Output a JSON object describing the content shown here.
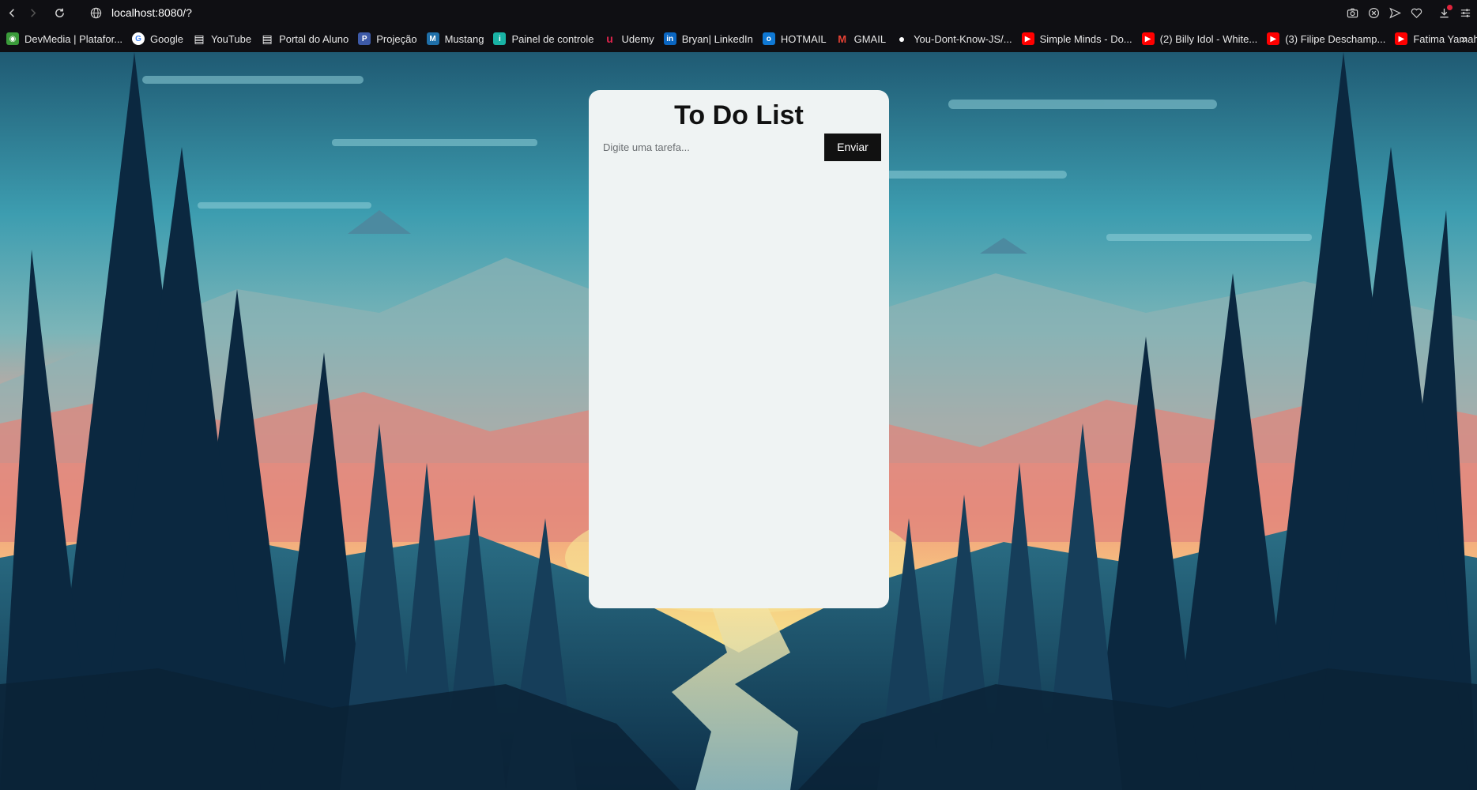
{
  "browser": {
    "url": "localhost:8080/?",
    "bookmarks": [
      {
        "label": "DevMedia | Platafor...",
        "icon": "devmedia-icon",
        "color": "#3a9b3a"
      },
      {
        "label": "Google",
        "icon": "google-icon",
        "color": "#ffffff"
      },
      {
        "label": "YouTube",
        "icon": "document-icon",
        "color": "#ffffff"
      },
      {
        "label": "Portal do Aluno",
        "icon": "document-icon",
        "color": "#ffffff"
      },
      {
        "label": "Projeção",
        "icon": "projecao-icon",
        "color": "#3d5aa8"
      },
      {
        "label": "Mustang",
        "icon": "mustang-icon",
        "color": "#1f6fa8"
      },
      {
        "label": "Painel de controle",
        "icon": "panel-icon",
        "color": "#19b3a5"
      },
      {
        "label": "Udemy",
        "icon": "udemy-icon",
        "color": "#e0244c"
      },
      {
        "label": "Bryan| LinkedIn",
        "icon": "linkedin-icon",
        "color": "#0a66c2"
      },
      {
        "label": "HOTMAIL",
        "icon": "outlook-icon",
        "color": "#0f78d4"
      },
      {
        "label": "GMAIL",
        "icon": "gmail-icon",
        "color": "#ea4335"
      },
      {
        "label": "You-Dont-Know-JS/...",
        "icon": "github-icon",
        "color": "#ffffff"
      },
      {
        "label": "Simple Minds - Do...",
        "icon": "youtube-icon",
        "color": "#ff0000"
      },
      {
        "label": "(2) Billy Idol - White...",
        "icon": "youtube-icon",
        "color": "#ff0000"
      },
      {
        "label": "(3) Filipe Deschamp...",
        "icon": "youtube-icon",
        "color": "#ff0000"
      },
      {
        "label": "Fatima Yamaha - W...",
        "icon": "youtube-icon",
        "color": "#ff0000"
      }
    ],
    "more_label": "»"
  },
  "todo": {
    "title": "To Do List",
    "input_placeholder": "Digite uma tarefa...",
    "input_value": "",
    "send_label": "Enviar",
    "tasks": []
  },
  "colors": {
    "card_bg": "#eff3f3",
    "button_bg": "#111111",
    "chrome_bg": "#0f0f13"
  }
}
